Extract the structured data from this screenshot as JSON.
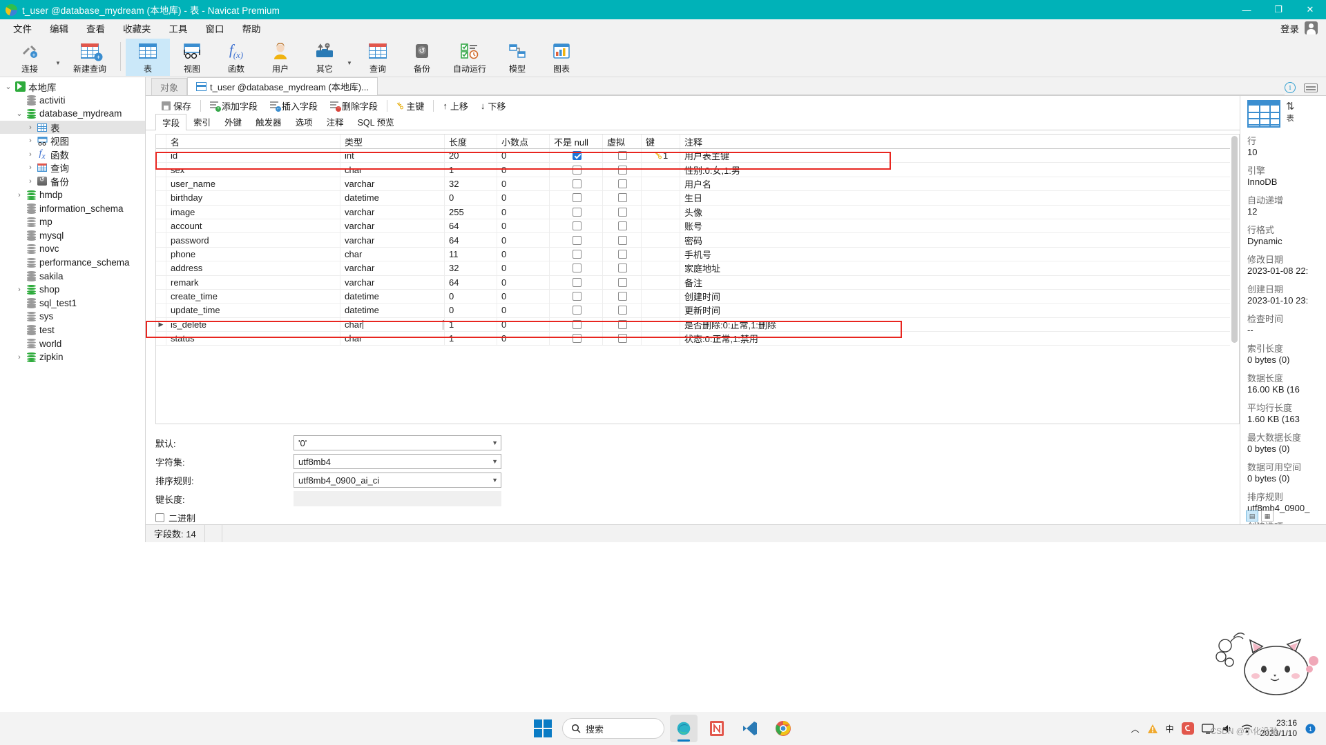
{
  "window": {
    "title": "t_user @database_mydream (本地库) - 表 - Navicat Premium",
    "minimize": "—",
    "maximize": "❐",
    "close": "✕",
    "accent": "#00b2b8"
  },
  "menubar": {
    "items": [
      "文件",
      "编辑",
      "查看",
      "收藏夹",
      "工具",
      "窗口",
      "帮助"
    ],
    "login": "登录"
  },
  "toolbar": {
    "items": [
      {
        "label": "连接",
        "icon": "connection-icon",
        "dropdown": true
      },
      {
        "label": "新建查询",
        "icon": "new-query-icon",
        "dropdown": false
      },
      {
        "label": "表",
        "icon": "table-icon",
        "active": true
      },
      {
        "label": "视图",
        "icon": "view-icon"
      },
      {
        "label": "函数",
        "icon": "function-icon"
      },
      {
        "label": "用户",
        "icon": "user-icon"
      },
      {
        "label": "其它",
        "icon": "other-tools-icon",
        "dropdown": true
      },
      {
        "label": "查询",
        "icon": "query-icon"
      },
      {
        "label": "备份",
        "icon": "backup-icon"
      },
      {
        "label": "自动运行",
        "icon": "automation-icon"
      },
      {
        "label": "模型",
        "icon": "model-icon"
      },
      {
        "label": "图表",
        "icon": "chart-icon"
      }
    ]
  },
  "sidebar": {
    "nodes": [
      {
        "label": "本地库",
        "icon": "connection-icon",
        "indent": 0,
        "twisty": "v",
        "selected": false
      },
      {
        "label": "activiti",
        "icon": "database-icon",
        "indent": 1,
        "twisty": "",
        "selected": false
      },
      {
        "label": "database_mydream",
        "icon": "database-icon-green",
        "indent": 1,
        "twisty": "v",
        "selected": false
      },
      {
        "label": "表",
        "icon": "table-icon",
        "indent": 2,
        "twisty": ">",
        "selected": true
      },
      {
        "label": "视图",
        "icon": "view-icon",
        "indent": 2,
        "twisty": ">",
        "selected": false
      },
      {
        "label": "函数",
        "icon": "function-icon",
        "indent": 2,
        "twisty": ">",
        "selected": false
      },
      {
        "label": "查询",
        "icon": "query-icon",
        "indent": 2,
        "twisty": ">",
        "selected": false
      },
      {
        "label": "备份",
        "icon": "backup-icon",
        "indent": 2,
        "twisty": ">",
        "selected": false
      },
      {
        "label": "hmdp",
        "icon": "database-icon-green",
        "indent": 1,
        "twisty": ">",
        "selected": false
      },
      {
        "label": "information_schema",
        "icon": "database-icon",
        "indent": 1,
        "twisty": "",
        "selected": false
      },
      {
        "label": "mp",
        "icon": "database-icon",
        "indent": 1,
        "twisty": "",
        "selected": false
      },
      {
        "label": "mysql",
        "icon": "database-icon",
        "indent": 1,
        "twisty": "",
        "selected": false
      },
      {
        "label": "novc",
        "icon": "database-icon",
        "indent": 1,
        "twisty": "",
        "selected": false
      },
      {
        "label": "performance_schema",
        "icon": "database-icon",
        "indent": 1,
        "twisty": "",
        "selected": false
      },
      {
        "label": "sakila",
        "icon": "database-icon",
        "indent": 1,
        "twisty": "",
        "selected": false
      },
      {
        "label": "shop",
        "icon": "database-icon-green",
        "indent": 1,
        "twisty": ">",
        "selected": false
      },
      {
        "label": "sql_test1",
        "icon": "database-icon",
        "indent": 1,
        "twisty": "",
        "selected": false
      },
      {
        "label": "sys",
        "icon": "database-icon",
        "indent": 1,
        "twisty": "",
        "selected": false
      },
      {
        "label": "test",
        "icon": "database-icon",
        "indent": 1,
        "twisty": "",
        "selected": false
      },
      {
        "label": "world",
        "icon": "database-icon",
        "indent": 1,
        "twisty": "",
        "selected": false
      },
      {
        "label": "zipkin",
        "icon": "database-icon-green",
        "indent": 1,
        "twisty": ">",
        "selected": false
      }
    ]
  },
  "tabs": [
    {
      "label": "对象",
      "active": false,
      "icon": ""
    },
    {
      "label": "t_user @database_mydream (本地库)...",
      "active": true,
      "icon": "table-edit-icon"
    }
  ],
  "actions": [
    {
      "label": "保存",
      "icon": "save-icon"
    },
    {
      "label": "添加字段",
      "icon": "add-field-icon"
    },
    {
      "label": "插入字段",
      "icon": "insert-field-icon"
    },
    {
      "label": "删除字段",
      "icon": "delete-field-icon"
    },
    {
      "label": "主键",
      "icon": "primary-key-icon"
    },
    {
      "label": "上移",
      "icon": "move-up-icon"
    },
    {
      "label": "下移",
      "icon": "move-down-icon"
    }
  ],
  "subtabs": [
    {
      "label": "字段",
      "active": true
    },
    {
      "label": "索引",
      "active": false
    },
    {
      "label": "外键",
      "active": false
    },
    {
      "label": "触发器",
      "active": false
    },
    {
      "label": "选项",
      "active": false
    },
    {
      "label": "注释",
      "active": false
    },
    {
      "label": "SQL 预览",
      "active": false
    }
  ],
  "grid": {
    "columns": [
      "名",
      "类型",
      "长度",
      "小数点",
      "不是 null",
      "虚拟",
      "键",
      "注释"
    ],
    "rows": [
      {
        "name": "id",
        "type": "int",
        "length": "20",
        "decimals": "0",
        "notnull": true,
        "virtual": false,
        "key": "1",
        "comment": "用户表主键",
        "highlight": false,
        "editing": false,
        "current": false
      },
      {
        "name": "sex",
        "type": "char",
        "length": "1",
        "decimals": "0",
        "notnull": false,
        "virtual": false,
        "key": "",
        "comment": "性别:0:女,1:男",
        "highlight": true,
        "editing": false,
        "current": false
      },
      {
        "name": "user_name",
        "type": "varchar",
        "length": "32",
        "decimals": "0",
        "notnull": false,
        "virtual": false,
        "key": "",
        "comment": "用户名",
        "highlight": false,
        "editing": false,
        "current": false
      },
      {
        "name": "birthday",
        "type": "datetime",
        "length": "0",
        "decimals": "0",
        "notnull": false,
        "virtual": false,
        "key": "",
        "comment": "生日",
        "highlight": false,
        "editing": false,
        "current": false
      },
      {
        "name": "image",
        "type": "varchar",
        "length": "255",
        "decimals": "0",
        "notnull": false,
        "virtual": false,
        "key": "",
        "comment": "头像",
        "highlight": false,
        "editing": false,
        "current": false
      },
      {
        "name": "account",
        "type": "varchar",
        "length": "64",
        "decimals": "0",
        "notnull": false,
        "virtual": false,
        "key": "",
        "comment": "账号",
        "highlight": false,
        "editing": false,
        "current": false
      },
      {
        "name": "password",
        "type": "varchar",
        "length": "64",
        "decimals": "0",
        "notnull": false,
        "virtual": false,
        "key": "",
        "comment": "密码",
        "highlight": false,
        "editing": false,
        "current": false
      },
      {
        "name": "phone",
        "type": "char",
        "length": "11",
        "decimals": "0",
        "notnull": false,
        "virtual": false,
        "key": "",
        "comment": "手机号",
        "highlight": false,
        "editing": false,
        "current": false
      },
      {
        "name": "address",
        "type": "varchar",
        "length": "32",
        "decimals": "0",
        "notnull": false,
        "virtual": false,
        "key": "",
        "comment": "家庭地址",
        "highlight": false,
        "editing": false,
        "current": false
      },
      {
        "name": "remark",
        "type": "varchar",
        "length": "64",
        "decimals": "0",
        "notnull": false,
        "virtual": false,
        "key": "",
        "comment": "备注",
        "highlight": false,
        "editing": false,
        "current": false
      },
      {
        "name": "create_time",
        "type": "datetime",
        "length": "0",
        "decimals": "0",
        "notnull": false,
        "virtual": false,
        "key": "",
        "comment": "创建时间",
        "highlight": false,
        "editing": false,
        "current": false
      },
      {
        "name": "update_time",
        "type": "datetime",
        "length": "0",
        "decimals": "0",
        "notnull": false,
        "virtual": false,
        "key": "",
        "comment": "更新时间",
        "highlight": false,
        "editing": false,
        "current": false
      },
      {
        "name": "is_delete",
        "type": "char",
        "length": "1",
        "decimals": "0",
        "notnull": false,
        "virtual": false,
        "key": "",
        "comment": "是否删除:0:正常,1:删除",
        "highlight": false,
        "editing": true,
        "current": true
      },
      {
        "name": "status",
        "type": "char",
        "length": "1",
        "decimals": "0",
        "notnull": false,
        "virtual": false,
        "key": "",
        "comment": "状态:0:正常,1:禁用",
        "highlight": true,
        "editing": false,
        "current": false
      }
    ]
  },
  "properties": [
    {
      "label": "默认:",
      "value": "'0'",
      "type": "combo"
    },
    {
      "label": "字符集:",
      "value": "utf8mb4",
      "type": "combo"
    },
    {
      "label": "排序规则:",
      "value": "utf8mb4_0900_ai_ci",
      "type": "combo"
    },
    {
      "label": "键长度:",
      "value": "",
      "type": "flat"
    }
  ],
  "binary_checkbox": {
    "label": "二进制",
    "checked": false
  },
  "infopanel": {
    "icon_caption": "表",
    "entries": [
      {
        "key": "行",
        "value": "10"
      },
      {
        "key": "引擎",
        "value": "InnoDB"
      },
      {
        "key": "自动递增",
        "value": "12"
      },
      {
        "key": "行格式",
        "value": "Dynamic"
      },
      {
        "key": "修改日期",
        "value": "2023-01-08 22:"
      },
      {
        "key": "创建日期",
        "value": "2023-01-10 23:"
      },
      {
        "key": "检查时间",
        "value": "--"
      },
      {
        "key": "索引长度",
        "value": "0 bytes (0)"
      },
      {
        "key": "数据长度",
        "value": "16.00 KB (16"
      },
      {
        "key": "平均行长度",
        "value": "1.60 KB (163"
      },
      {
        "key": "最大数据长度",
        "value": "0 bytes (0)"
      },
      {
        "key": "数据可用空间",
        "value": "0 bytes (0)"
      },
      {
        "key": "排序规则",
        "value": "utf8mb4_0900_"
      },
      {
        "key": "创建选项",
        "value": ""
      }
    ]
  },
  "statusbar": {
    "fields_count": "字段数: 14"
  },
  "taskbar": {
    "search_placeholder": "搜索",
    "apps": [
      "edge-icon",
      "navicat-icon",
      "vscode-icon",
      "chrome-icon"
    ],
    "tray": {
      "ime": "中",
      "time": "23:16",
      "date": "2023/1/10"
    }
  },
  "watermark": "CSDN @小化没劲"
}
